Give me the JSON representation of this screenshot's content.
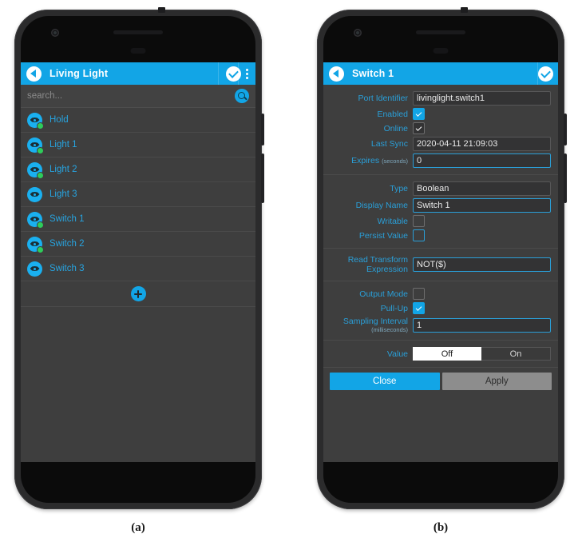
{
  "figure": {
    "caption_a": "(a)",
    "caption_b": "(b)"
  },
  "colors": {
    "accent": "#12a5e6",
    "link": "#27a4e0",
    "status_online": "#2ecc5a",
    "screen_bg": "#3e3e3e",
    "input_bg": "#333334",
    "secondary_button": "#8d8d8d"
  },
  "phone_a": {
    "appbar": {
      "back_label": "back",
      "title": "Living Light",
      "confirm_label": "confirm",
      "menu_label": "more options"
    },
    "search": {
      "placeholder": "search...",
      "value": "",
      "icon": "search-icon"
    },
    "list": {
      "items": [
        {
          "label": "Hold",
          "icon": "port-icon",
          "online": true
        },
        {
          "label": "Light 1",
          "icon": "port-icon",
          "online": true
        },
        {
          "label": "Light 2",
          "icon": "port-icon",
          "online": true
        },
        {
          "label": "Light 3",
          "icon": "port-icon",
          "online": false
        },
        {
          "label": "Switch 1",
          "icon": "port-icon",
          "online": true
        },
        {
          "label": "Switch 2",
          "icon": "port-icon",
          "online": true
        },
        {
          "label": "Switch 3",
          "icon": "port-icon",
          "online": false
        }
      ],
      "add_label": "add"
    }
  },
  "phone_b": {
    "appbar": {
      "back_label": "back",
      "title": "Switch 1",
      "confirm_label": "confirm"
    },
    "sections": [
      {
        "fields": [
          {
            "type": "text",
            "label": "Port Identifier",
            "value": "livinglight.switch1",
            "focused": false
          },
          {
            "type": "checkbox",
            "label": "Enabled",
            "checked": true,
            "style": "on-blue"
          },
          {
            "type": "checkbox",
            "label": "Online",
            "checked": true,
            "style": "on-dark"
          },
          {
            "type": "text",
            "label": "Last Sync",
            "value": "2020-04-11 21:09:03",
            "focused": false
          },
          {
            "type": "text",
            "label": "Expires",
            "sublabel": "(seconds)",
            "value": "0",
            "focused": true
          }
        ]
      },
      {
        "fields": [
          {
            "type": "text",
            "label": "Type",
            "value": "Boolean",
            "focused": false
          },
          {
            "type": "text",
            "label": "Display Name",
            "value": "Switch 1",
            "focused": true
          },
          {
            "type": "checkbox",
            "label": "Writable",
            "checked": false,
            "style": "off-gray"
          },
          {
            "type": "checkbox",
            "label": "Persist Value",
            "checked": false,
            "style": "off-blue"
          }
        ]
      },
      {
        "fields": [
          {
            "type": "text",
            "label": "Read Transform",
            "label2": "Expression",
            "value": "NOT($)",
            "focused": true
          }
        ]
      },
      {
        "fields": [
          {
            "type": "checkbox",
            "label": "Output Mode",
            "checked": false,
            "style": "off-gray"
          },
          {
            "type": "checkbox",
            "label": "Pull-Up",
            "checked": true,
            "style": "on-blue"
          },
          {
            "type": "text",
            "label": "Sampling Interval",
            "sublabel2": "(milliseconds)",
            "value": "1",
            "focused": true
          }
        ]
      }
    ],
    "value_field": {
      "label": "Value",
      "options": [
        "Off",
        "On"
      ],
      "selected": "Off"
    },
    "buttons": {
      "close": "Close",
      "apply": "Apply"
    }
  }
}
